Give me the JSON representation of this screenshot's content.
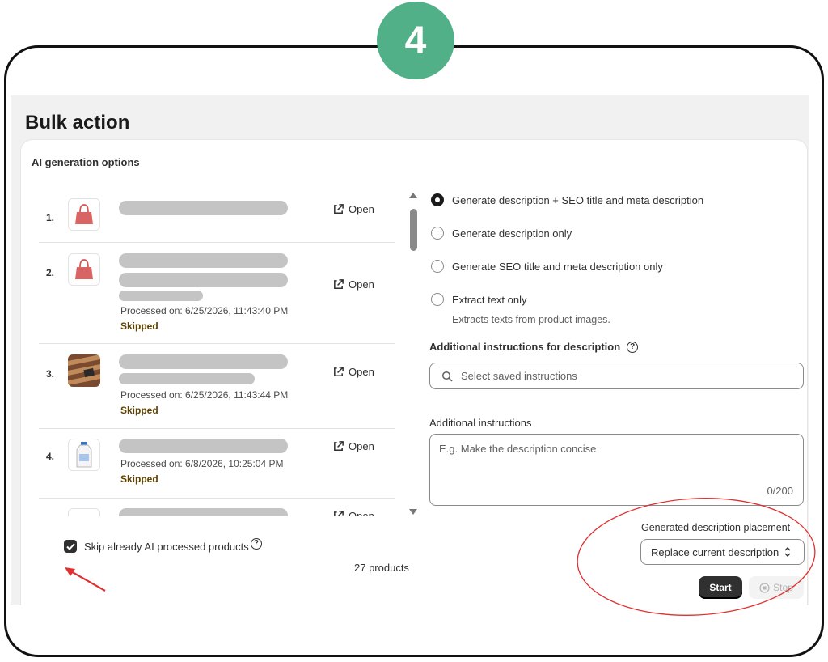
{
  "step_badge": "4",
  "page_title": "Bulk action",
  "card_title": "AI generation options",
  "products": [
    {
      "index": "1.",
      "open_label": "Open",
      "processed": "",
      "status": ""
    },
    {
      "index": "2.",
      "open_label": "Open",
      "processed": "Processed on: 6/25/2026, 11:43:40 PM",
      "status": "Skipped"
    },
    {
      "index": "3.",
      "open_label": "Open",
      "processed": "Processed on: 6/25/2026, 11:43:44 PM",
      "status": "Skipped"
    },
    {
      "index": "4.",
      "open_label": "Open",
      "processed": "Processed on: 6/8/2026, 10:25:04 PM",
      "status": "Skipped"
    },
    {
      "index": "",
      "open_label": "Open",
      "processed": "",
      "status": ""
    }
  ],
  "options": [
    {
      "label": "Generate description + SEO title and meta description",
      "selected": true
    },
    {
      "label": "Generate description only",
      "selected": false
    },
    {
      "label": "Generate SEO title and meta description only",
      "selected": false
    },
    {
      "label": "Extract text only",
      "selected": false,
      "sublabel": "Extracts texts from product images."
    }
  ],
  "additional_instructions_heading": "Additional instructions for description",
  "saved_instructions_placeholder": "Select saved instructions",
  "additional_instructions_label": "Additional instructions",
  "additional_instructions_placeholder": "E.g. Make the description concise",
  "char_count": "0/200",
  "skip_label": "Skip already AI processed products",
  "skip_checked": true,
  "products_count": "27 products",
  "placement_label": "Generated description placement",
  "placement_value": "Replace current description",
  "start_label": "Start",
  "stop_label": "Stop",
  "colors": {
    "badge": "#52b088",
    "annotation": "#e03030",
    "status_text": "#5e4200"
  }
}
